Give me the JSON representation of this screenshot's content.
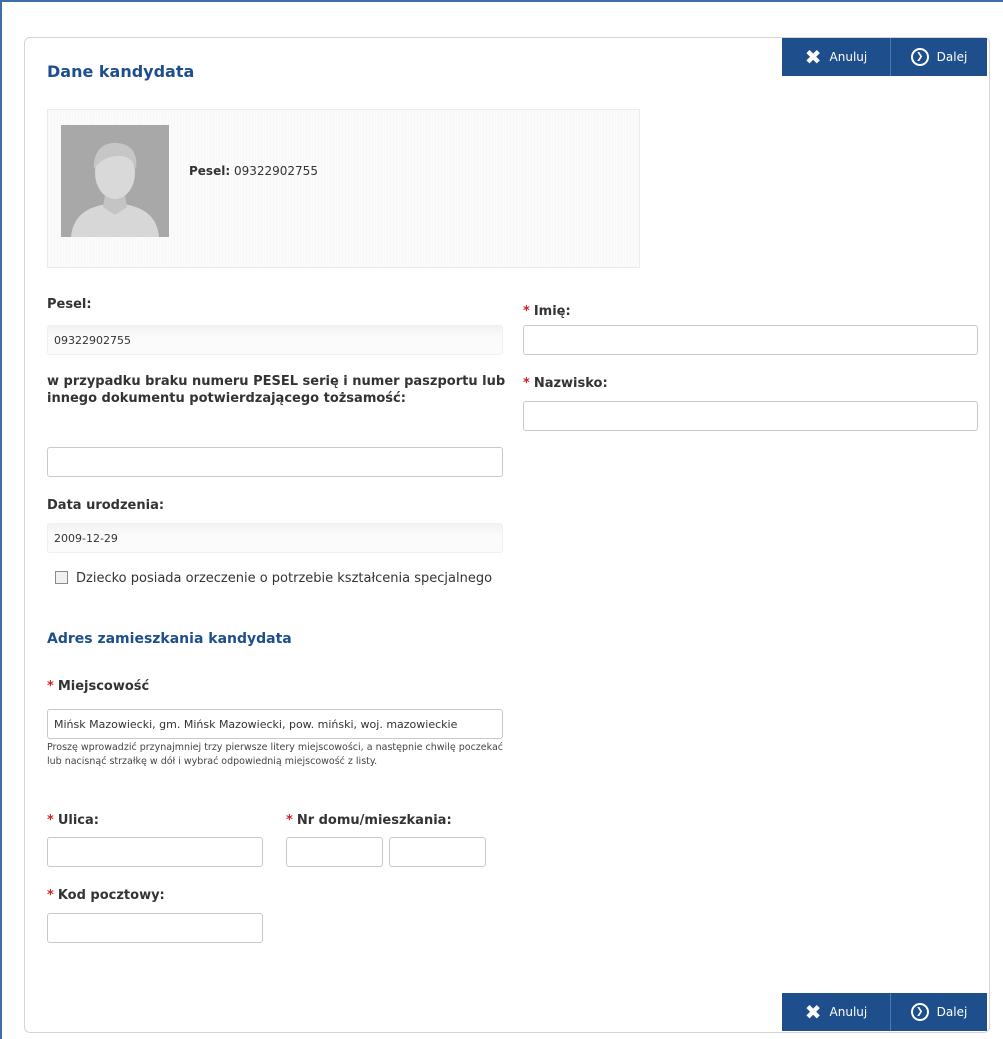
{
  "buttons": {
    "cancel_label": "Anuluj",
    "next_label": "Dalej"
  },
  "page_title": "Dane kandydata",
  "info_box": {
    "pesel_label": "Pesel:",
    "pesel_value": "09322902755"
  },
  "form": {
    "pesel": {
      "label": "Pesel:",
      "value": "09322902755"
    },
    "imie": {
      "label": "Imię:",
      "value": ""
    },
    "nazwisko": {
      "label": "Nazwisko:",
      "value": ""
    },
    "document": {
      "label": "w przypadku braku numeru PESEL serię i numer paszportu lub innego dokumentu potwierdzającego tożsamość:",
      "value": ""
    },
    "birth_date": {
      "label": "Data urodzenia:",
      "value": "2009-12-29"
    },
    "special_needs": {
      "label": "Dziecko posiada orzeczenie o potrzebie kształcenia specjalnego",
      "checked": false
    }
  },
  "address": {
    "section_title": "Adres zamieszkania kandydata",
    "city": {
      "label": "Miejscowość",
      "value": "Mińsk Mazowiecki, gm. Mińsk Mazowiecki, pow. miński, woj. mazowieckie",
      "hint": "Proszę wprowadzić przynajmniej trzy pierwsze litery miejscowości, a następnie chwilę poczekać lub nacisnąć strzałkę w dół i wybrać odpowiednią miejscowość z listy."
    },
    "street": {
      "label": "Ulica:",
      "value": ""
    },
    "house_number": {
      "label": "Nr domu/mieszkania:",
      "house_value": "",
      "flat_value": ""
    },
    "postal_code": {
      "label": "Kod pocztowy:",
      "value": ""
    }
  },
  "required_marker": "*",
  "colors": {
    "brand_blue": "#1e4f8c",
    "required_red": "#cc2222"
  },
  "icons": {
    "cancel": "close-icon",
    "next": "next-circle-icon",
    "avatar": "user-silhouette-icon"
  }
}
